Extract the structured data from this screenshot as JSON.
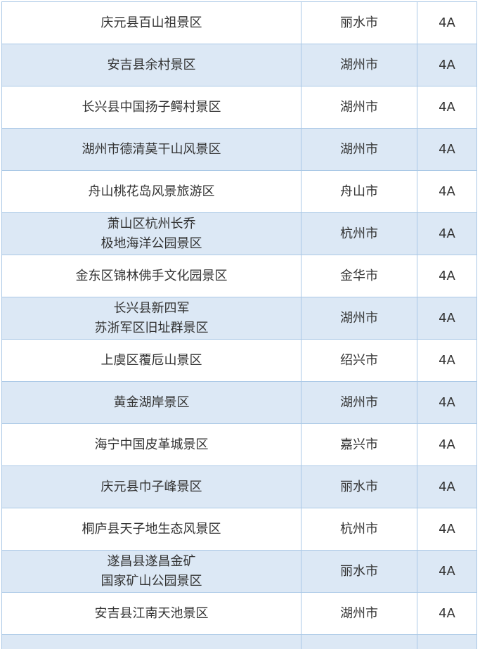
{
  "colors": {
    "row_alt_bg": "#dce8f5",
    "border": "#aac8e6",
    "text": "#333333"
  },
  "rows": [
    {
      "name": [
        "庆元县百山祖景区"
      ],
      "city": "丽水市",
      "level": "4A"
    },
    {
      "name": [
        "安吉县余村景区"
      ],
      "city": "湖州市",
      "level": "4A"
    },
    {
      "name": [
        "长兴县中国扬子鳄村景区"
      ],
      "city": "湖州市",
      "level": "4A"
    },
    {
      "name": [
        "湖州市德清莫干山风景区"
      ],
      "city": "湖州市",
      "level": "4A"
    },
    {
      "name": [
        "舟山桃花岛风景旅游区"
      ],
      "city": "舟山市",
      "level": "4A"
    },
    {
      "name": [
        "萧山区杭州长乔",
        "极地海洋公园景区"
      ],
      "city": "杭州市",
      "level": "4A"
    },
    {
      "name": [
        "金东区锦林佛手文化园景区"
      ],
      "city": "金华市",
      "level": "4A"
    },
    {
      "name": [
        "长兴县新四军",
        "苏浙军区旧址群景区"
      ],
      "city": "湖州市",
      "level": "4A"
    },
    {
      "name": [
        "上虞区覆卮山景区"
      ],
      "city": "绍兴市",
      "level": "4A"
    },
    {
      "name": [
        "黄金湖岸景区"
      ],
      "city": "湖州市",
      "level": "4A"
    },
    {
      "name": [
        "海宁中国皮革城景区"
      ],
      "city": "嘉兴市",
      "level": "4A"
    },
    {
      "name": [
        "庆元县巾子峰景区"
      ],
      "city": "丽水市",
      "level": "4A"
    },
    {
      "name": [
        "桐庐县天子地生态风景区"
      ],
      "city": "杭州市",
      "level": "4A"
    },
    {
      "name": [
        "遂昌县遂昌金矿",
        "国家矿山公园景区"
      ],
      "city": "丽水市",
      "level": "4A"
    },
    {
      "name": [
        "安吉县江南天池景区"
      ],
      "city": "湖州市",
      "level": "4A"
    },
    {
      "name": [
        ""
      ],
      "city": "",
      "level": ""
    }
  ]
}
